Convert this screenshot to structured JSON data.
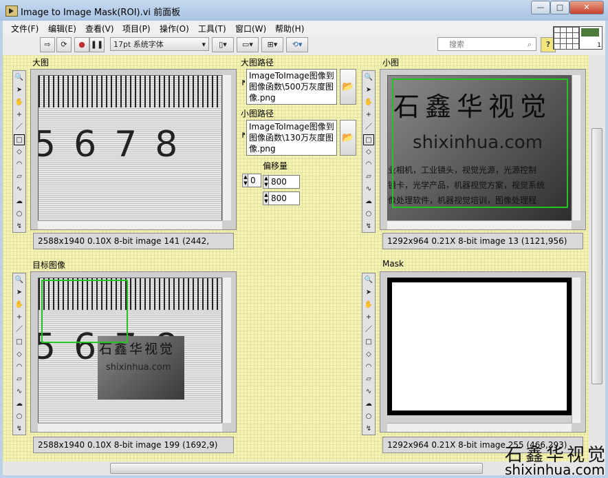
{
  "window": {
    "title": "Image to Image Mask(ROI).vi 前面板"
  },
  "menu": [
    "文件(F)",
    "编辑(E)",
    "查看(V)",
    "项目(P)",
    "操作(O)",
    "工具(T)",
    "窗口(W)",
    "帮助(H)"
  ],
  "toolbar": {
    "font": "17pt 系统字体",
    "search_placeholder": "搜索",
    "help": "?"
  },
  "vi_icon": {
    "number": "1"
  },
  "big_image": {
    "label": "大图",
    "digits": "5678",
    "status": "2588x1940 0.10X 8-bit image 141     (2442,"
  },
  "big_path": {
    "label": "大图路径",
    "value": "ImageToImage图像到图像函数\\500万灰度图像.png"
  },
  "small_path": {
    "label": "小图路径",
    "value": "ImageToImage图像到图像函数\\130万灰度图像.png"
  },
  "offset": {
    "label": "偏移量",
    "index": "0",
    "x": "800",
    "y": "800"
  },
  "small_image": {
    "label": "小图",
    "status": "1292x964 0.21X 8-bit image 13     (1121,956)",
    "logo_text": "石鑫华视觉",
    "url_text": "shixinhua.com",
    "caption_line1": "业相机，工业镜头，视觉光源，光源控制",
    "caption_line2": "镜卡，光学产品，机器视觉方案，视觉系统",
    "caption_line3": "像处理软件，机器视觉培训，图像处理程"
  },
  "target_image": {
    "label": "目标图像",
    "digits": "5678",
    "status": "2588x1940 0.10X 8-bit image 199     (1692,9)"
  },
  "mask_image": {
    "label": "Mask",
    "status": "1292x964 0.21X 8-bit image 255     (466,293)"
  },
  "watermark": {
    "cn": "石鑫华视觉",
    "url": "shixinhua.com"
  },
  "colors": {
    "panel_bg": "#f5f3b4",
    "roi": "#22c422"
  }
}
